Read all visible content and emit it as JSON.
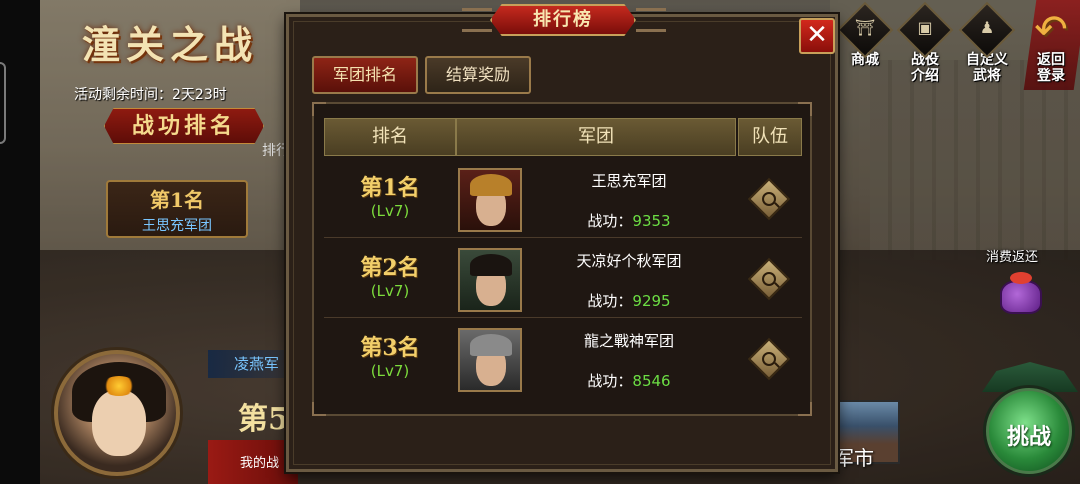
{
  "event": {
    "title": "潼关之战",
    "time_label": "活动剩余时间：2天23时",
    "rank_banner": "战功排名",
    "side_fragment": "排行",
    "first_card_rank": "第1名",
    "first_card_name": "王思充军团",
    "lingyan": "凌燕军",
    "fifth_rank": "第5",
    "my_bar": "我的战"
  },
  "top_icons": [
    {
      "icon": "shop-icon",
      "label": "商城"
    },
    {
      "icon": "campaign-intro-icon",
      "label": "战役\n介绍"
    },
    {
      "icon": "custom-general-icon",
      "label": "自定义\n武将"
    },
    {
      "icon": "back-arrow-icon",
      "label": "返回\n登录"
    }
  ],
  "consume_return": "消费返还",
  "challenge": "挑战",
  "shop_fragment": "军市",
  "dialog": {
    "title": "排行榜",
    "tabs": [
      {
        "label": "军团排名",
        "active": true
      },
      {
        "label": "结算奖励",
        "active": false
      }
    ],
    "columns": [
      "排名",
      "军团",
      "队伍"
    ],
    "rows": [
      {
        "rank": "第1名",
        "level": "(Lv7)",
        "legion": "王思充军团",
        "merit_label": "战功：",
        "merit": "9353"
      },
      {
        "rank": "第2名",
        "level": "(Lv7)",
        "legion": "天凉好个秋军团",
        "merit_label": "战功：",
        "merit": "9295"
      },
      {
        "rank": "第3名",
        "level": "(Lv7)",
        "legion": "龍之戰神军团",
        "merit_label": "战功：",
        "merit": "8546"
      }
    ]
  },
  "colors": {
    "accent_red": "#c52a1e",
    "gold": "#f2cf6a",
    "level_green": "#7cdc3c",
    "merit_green": "#6cde44",
    "name_blue": "#79c6ff"
  }
}
